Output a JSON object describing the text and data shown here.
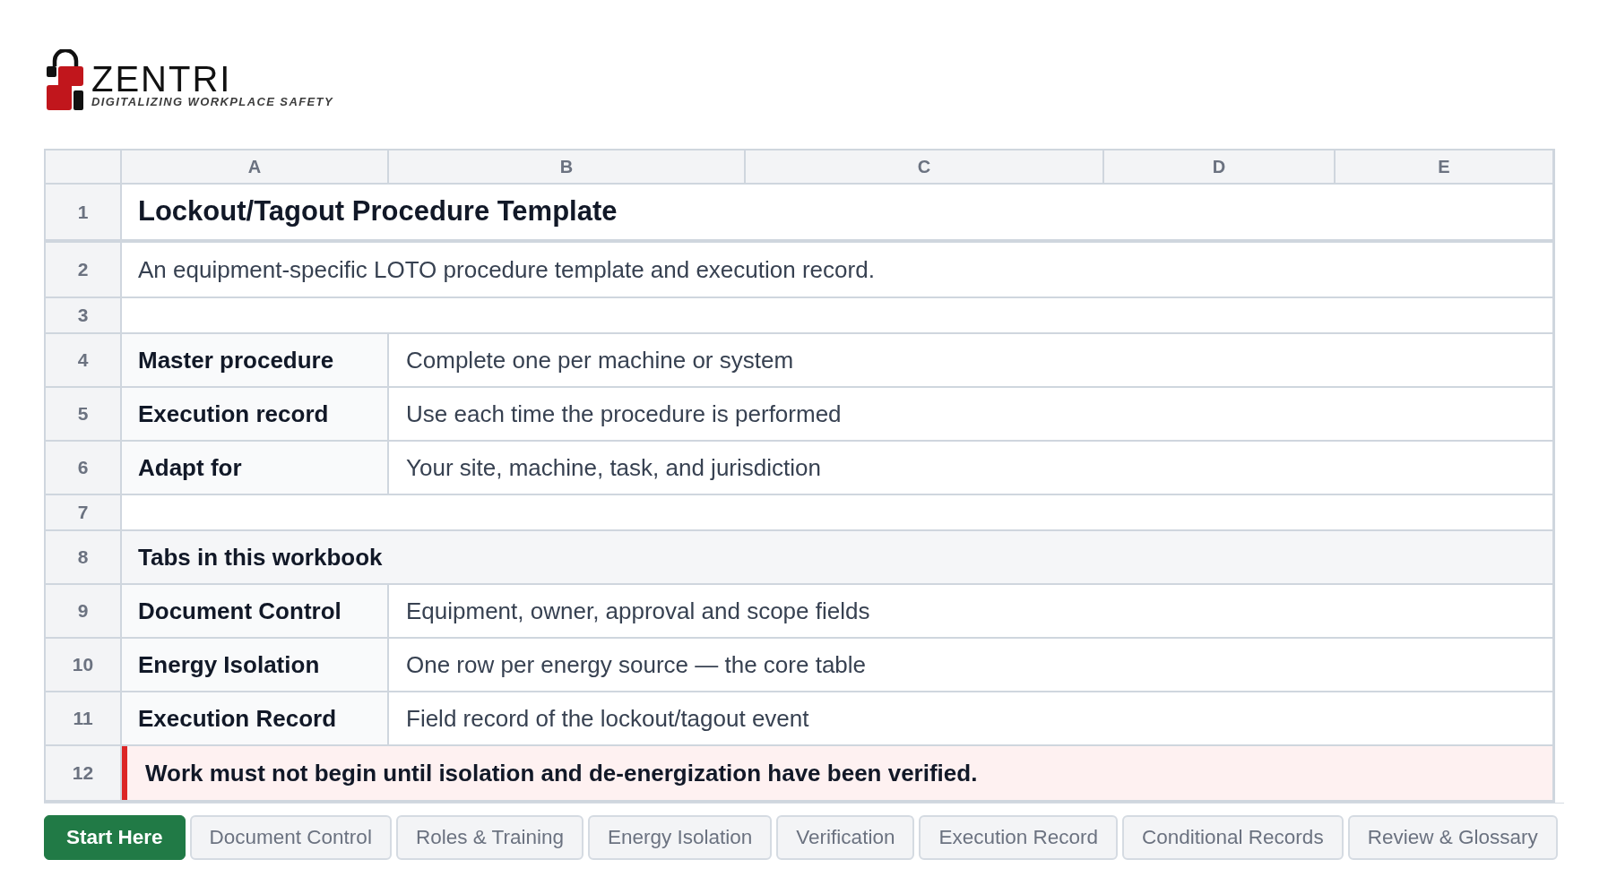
{
  "logo": {
    "wordmark": "ZENTRI",
    "tagline": "DIGITALIZING WORKPLACE SAFETY"
  },
  "sheet": {
    "columns": [
      "A",
      "B",
      "C",
      "D",
      "E"
    ],
    "rows": [
      {
        "number": "1",
        "kind": "title",
        "text": "Lockout/Tagout Procedure Template"
      },
      {
        "number": "2",
        "kind": "text",
        "text": "An equipment-specific LOTO procedure template and execution record."
      },
      {
        "number": "3",
        "kind": "blank"
      },
      {
        "number": "4",
        "kind": "pair",
        "label": "Master procedure",
        "value": "Complete one per machine or system"
      },
      {
        "number": "5",
        "kind": "pair",
        "label": "Execution record",
        "value": "Use each time the procedure is performed"
      },
      {
        "number": "6",
        "kind": "pair",
        "label": "Adapt for",
        "value": "Your site, machine, task, and jurisdiction"
      },
      {
        "number": "7",
        "kind": "blank"
      },
      {
        "number": "8",
        "kind": "section",
        "text": "Tabs in this workbook"
      },
      {
        "number": "9",
        "kind": "pair",
        "label": "Document Control",
        "value": "Equipment, owner, approval and scope fields"
      },
      {
        "number": "10",
        "kind": "pair",
        "label": "Energy Isolation",
        "value": "One row per energy source — the core table"
      },
      {
        "number": "11",
        "kind": "pair",
        "label": "Execution Record",
        "value": "Field record of the lockout/tagout event"
      },
      {
        "number": "12",
        "kind": "warning",
        "text": "Work must not begin until isolation and de-energization have been verified."
      }
    ]
  },
  "tabs": [
    {
      "label": "Start Here",
      "selected": true
    },
    {
      "label": "Document Control",
      "selected": false
    },
    {
      "label": "Roles & Training",
      "selected": false
    },
    {
      "label": "Energy Isolation",
      "selected": false
    },
    {
      "label": "Verification",
      "selected": false
    },
    {
      "label": "Execution Record",
      "selected": false
    },
    {
      "label": "Conditional Records",
      "selected": false
    },
    {
      "label": "Review & Glossary",
      "selected": false
    }
  ]
}
